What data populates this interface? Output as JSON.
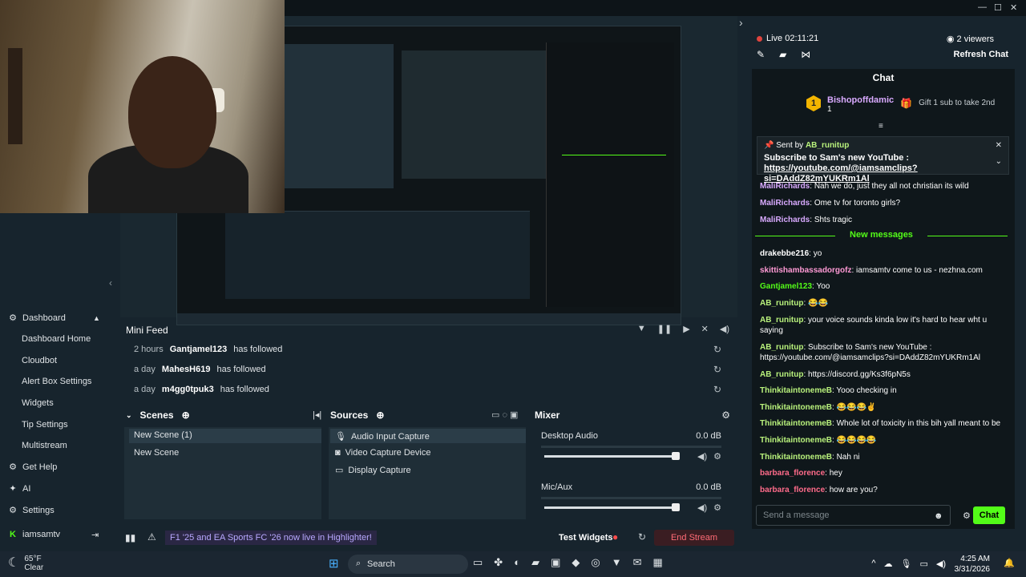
{
  "window": {
    "minimize": "—",
    "maximize": "☐",
    "close": "✕",
    "expand_arrow": "›"
  },
  "sidebar": {
    "items": [
      {
        "label": "Dashboard",
        "icon": "dashboard-icon",
        "glyph": "⚙"
      },
      {
        "label": "Dashboard Home"
      },
      {
        "label": "Cloudbot"
      },
      {
        "label": "Alert Box Settings"
      },
      {
        "label": "Widgets"
      },
      {
        "label": "Tip Settings"
      },
      {
        "label": "Multistream"
      },
      {
        "label": "Get Help",
        "glyph": "⚙"
      },
      {
        "label": "AI",
        "glyph": "✦"
      },
      {
        "label": "Settings",
        "glyph": "⚙"
      },
      {
        "label": "iamsamtv",
        "glyph": "K"
      }
    ]
  },
  "minifeed": {
    "title": "Mini Feed",
    "rows": [
      {
        "time": "2 hours",
        "name": "Gantjamel123",
        "action": "has followed"
      },
      {
        "time": "a day",
        "name": "MahesH619",
        "action": "has followed"
      },
      {
        "time": "a day",
        "name": "m4gg0tpuk3",
        "action": "has followed"
      }
    ]
  },
  "scenes": {
    "title": "Scenes",
    "items": [
      "New Scene (1)",
      "New Scene"
    ]
  },
  "sources": {
    "title": "Sources",
    "items": [
      "Audio Input Capture",
      "Video Capture Device",
      "Display Capture"
    ]
  },
  "mixer": {
    "title": "Mixer",
    "channels": [
      {
        "name": "Desktop Audio",
        "db": "0.0 dB",
        "level": 0.96
      },
      {
        "name": "Mic/Aux",
        "db": "0.0 dB",
        "level": 0.96
      }
    ]
  },
  "footer": {
    "alert": "F1 '25 and EA Sports FC '26 now live in Highlighter!",
    "test_widgets": "Test Widgets",
    "end_stream": "End Stream"
  },
  "stream": {
    "live": "Live 02:11:21",
    "viewers": "2 viewers",
    "refresh": "Refresh Chat"
  },
  "chat": {
    "title": "Chat",
    "gift": {
      "rank": "1",
      "name": "Bishopoffdamic",
      "sub": "1",
      "text": "Gift 1 sub to take 2nd"
    },
    "pinned": {
      "sent_by": "Sent by",
      "user": "AB_runitup",
      "line1": "Subscribe to Sam's new YouTube :",
      "line2": "https://youtube.com/@iamsamclips?si=DAddZ82mYUKRm1Al"
    },
    "messages_before": [
      {
        "user": "MaliRichards",
        "text": "Nah we do, just they all not christian its wild",
        "color": "#d9aaff"
      },
      {
        "user": "MaliRichards",
        "text": "Ome tv for toronto girls?",
        "color": "#d9aaff"
      },
      {
        "user": "MaliRichards",
        "text": "Shts tragic",
        "color": "#d9aaff"
      }
    ],
    "new_messages": "New messages",
    "messages_after": [
      {
        "user": "drakebbe216",
        "text": "yo",
        "color": "#ffffff"
      },
      {
        "user": "skittishambassadorgofz",
        "text": "iamsamtv come to us - nezhna.com",
        "color": "#ff9ad5"
      },
      {
        "user": "Gantjamel123",
        "text": "Yoo",
        "color": "#53fc18"
      },
      {
        "user": "AB_runitup",
        "text": "😂😂",
        "color": "#b9f27c"
      },
      {
        "user": "AB_runitup",
        "text": "your voice sounds kinda low it's hard to hear wht u saying",
        "color": "#b9f27c"
      },
      {
        "user": "AB_runitup",
        "text": "Subscribe to Sam's new YouTube : https://youtube.com/@iamsamclips?si=DAddZ82mYUKRm1Al",
        "color": "#b9f27c"
      },
      {
        "user": "AB_runitup",
        "text": "https://discord.gg/Ks3f6pN5s",
        "color": "#b9f27c"
      },
      {
        "user": "ThinkitaintonemeB",
        "text": "Yooo checking in",
        "color": "#b9f27c"
      },
      {
        "user": "ThinkitaintonemeB",
        "text": "😂😂😂✌",
        "color": "#b9f27c"
      },
      {
        "user": "ThinkitaintonemeB",
        "text": "Whole lot of toxicity in this bih yall meant to be",
        "color": "#b9f27c"
      },
      {
        "user": "ThinkitaintonemeB",
        "text": "😂😂😂😂",
        "color": "#b9f27c"
      },
      {
        "user": "ThinkitaintonemeB",
        "text": "Nah ni",
        "color": "#b9f27c"
      },
      {
        "user": "barbara_florence",
        "text": "hey",
        "color": "#ff6b8a"
      },
      {
        "user": "barbara_florence",
        "text": "how are you?",
        "color": "#ff6b8a"
      }
    ],
    "input_placeholder": "Send a message",
    "send": "Chat"
  },
  "taskbar": {
    "temp": "65°F",
    "weather": "Clear",
    "search": "Search",
    "time": "4:25 AM",
    "date": "3/31/2026"
  }
}
